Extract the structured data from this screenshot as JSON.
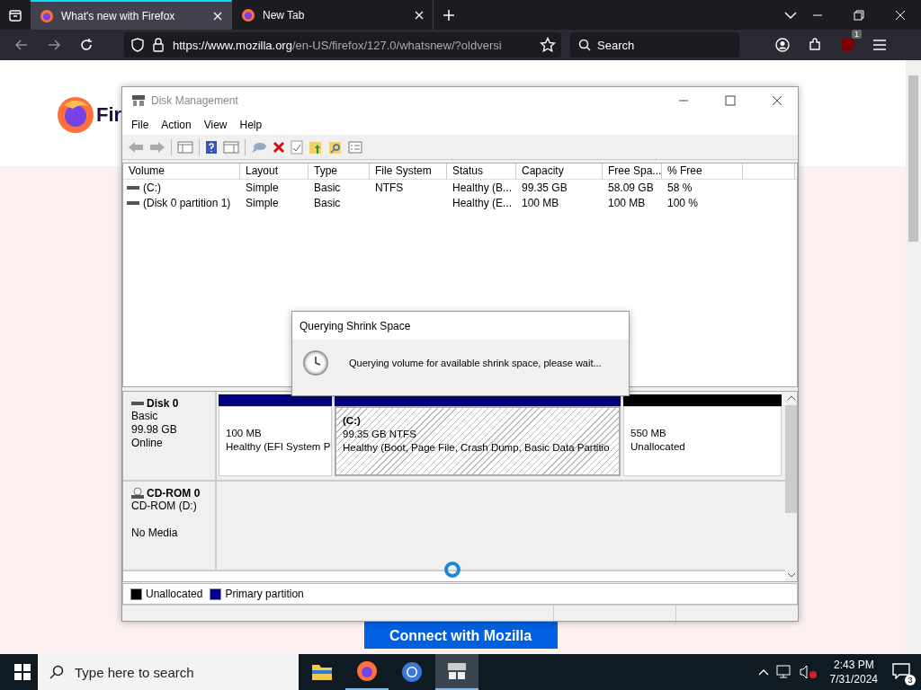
{
  "browser": {
    "tabs": [
      {
        "title": "What's new with Firefox",
        "selected": true
      },
      {
        "title": "New Tab",
        "selected": false
      }
    ],
    "url_host": "https://www.mozilla.org",
    "url_path": "/en-US/firefox/127.0/whatsnew/?oldversi",
    "search": {
      "placeholder": "Search"
    },
    "extension_badge": "1"
  },
  "page": {
    "brand": "Fir",
    "button": "Connect with Mozilla"
  },
  "disk_management": {
    "title": "Disk Management",
    "menu": [
      "File",
      "Action",
      "View",
      "Help"
    ],
    "columns": [
      "Volume",
      "Layout",
      "Type",
      "File System",
      "Status",
      "Capacity",
      "Free Spa...",
      "% Free"
    ],
    "rows": [
      [
        "(C:)",
        "Simple",
        "Basic",
        "NTFS",
        "Healthy (B...",
        "99.35 GB",
        "58.09 GB",
        "58 %"
      ],
      [
        "(Disk 0 partition 1)",
        "Simple",
        "Basic",
        "",
        "Healthy (E...",
        "100 MB",
        "100 MB",
        "100 %"
      ]
    ],
    "disks": [
      {
        "kind": "disk",
        "name": "Disk 0",
        "lines": [
          "Basic",
          "99.98 GB",
          "Online"
        ],
        "partitions": [
          {
            "kind": "primary",
            "selected": false,
            "lines": [
              "100 MB",
              "Healthy (EFI System P"
            ]
          },
          {
            "kind": "primary",
            "selected": true,
            "label": "(C:)",
            "lines": [
              "99.35 GB NTFS",
              "Healthy (Boot, Page File, Crash Dump, Basic Data Partitio"
            ]
          },
          {
            "kind": "unallocated",
            "selected": false,
            "lines": [
              "550 MB",
              "Unallocated"
            ]
          }
        ]
      },
      {
        "kind": "cdrom",
        "name": "CD-ROM 0",
        "lines": [
          "CD-ROM (D:)",
          "No Media"
        ]
      }
    ],
    "legend": [
      {
        "kind": "unallocated",
        "label": "Unallocated"
      },
      {
        "kind": "primary",
        "label": "Primary partition"
      }
    ]
  },
  "dialog": {
    "title": "Querying Shrink Space",
    "message": "Querying volume for available shrink space, please wait..."
  },
  "taskbar": {
    "search": {
      "placeholder": "Type here to search"
    },
    "time": "2:43 PM",
    "date": "7/31/2024",
    "notifications": "3"
  }
}
